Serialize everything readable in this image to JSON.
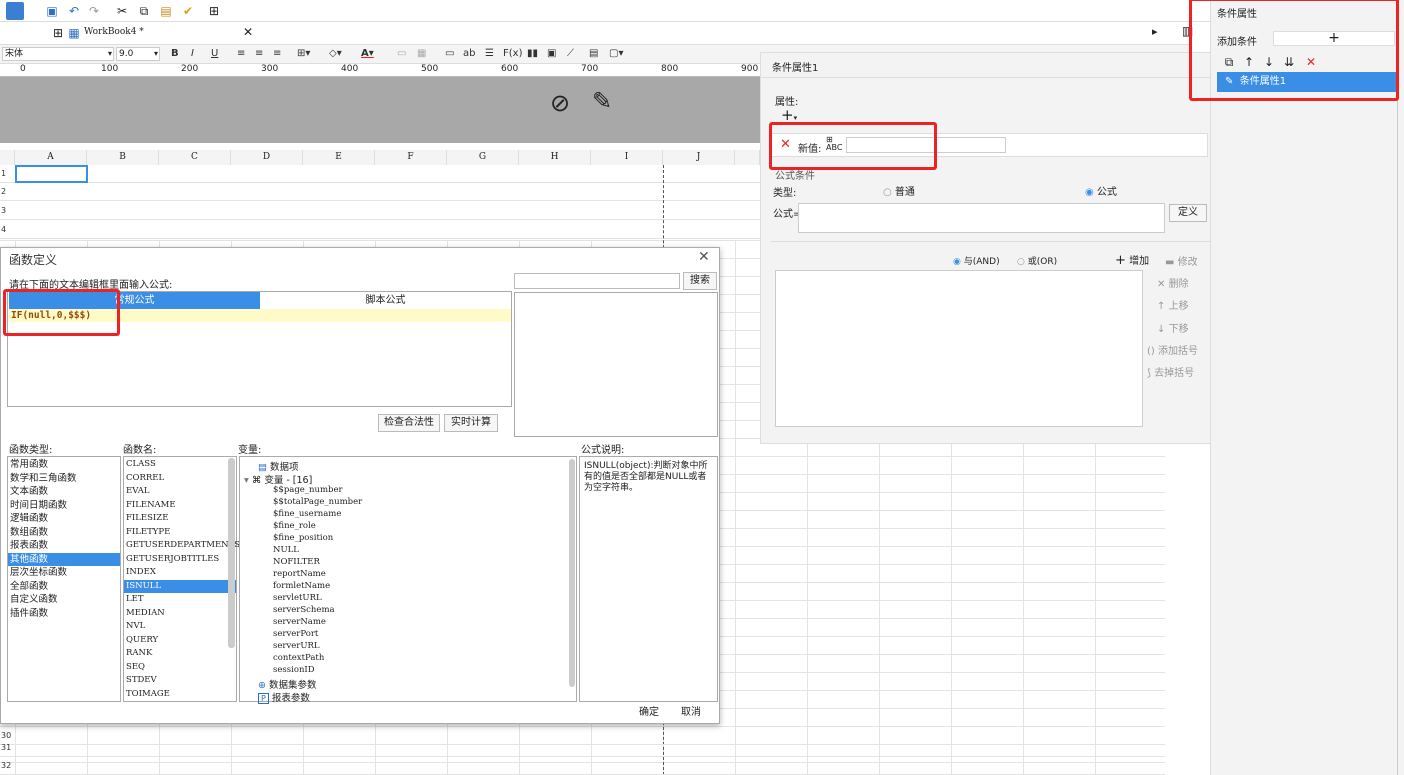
{
  "window": {
    "tab_title": "WorkBook4 *"
  },
  "format": {
    "font_name": "宋体",
    "font_size": "9.0"
  },
  "ruler": {
    "marks": [
      "0",
      "100",
      "200",
      "300",
      "400",
      "500",
      "600",
      "700",
      "800",
      "900"
    ]
  },
  "sheet": {
    "columns": [
      "A",
      "B",
      "C",
      "D",
      "E",
      "F",
      "G",
      "H",
      "I",
      "J"
    ],
    "rows_top": [
      "1",
      "2",
      "3",
      "4"
    ],
    "rows_bottom": [
      "30",
      "31",
      "32"
    ]
  },
  "dialog": {
    "title": "函数定义",
    "prompt": "请在下面的文本编辑框里面输入公式:",
    "search_placeholder": "",
    "search_button": "搜索",
    "tab_regular": "常规公式",
    "tab_script": "脚本公式",
    "formula_text": "IF(null,0,$$$)",
    "check_button": "检查合法性",
    "calc_button": "实时计算",
    "func_type_label": "函数类型:",
    "func_name_label": "函数名:",
    "var_label": "变量:",
    "desc_label": "公式说明:",
    "func_types": [
      "常用函数",
      "数学和三角函数",
      "文本函数",
      "时间日期函数",
      "逻辑函数",
      "数组函数",
      "报表函数",
      "其他函数",
      "层次坐标函数",
      "全部函数",
      "自定义函数",
      "插件函数"
    ],
    "func_type_selected": 7,
    "func_names": [
      "CLASS",
      "CORREL",
      "EVAL",
      "FILENAME",
      "FILESIZE",
      "FILETYPE",
      "GETUSERDEPARTMENTS",
      "GETUSERJOBTITLES",
      "INDEX",
      "ISNULL",
      "LET",
      "MEDIAN",
      "NVL",
      "QUERY",
      "RANK",
      "SEQ",
      "STDEV",
      "TOIMAGE"
    ],
    "func_name_selected": 9,
    "var_data_item": "数据项",
    "var_group": "变量 - [16]",
    "variables": [
      "$$page_number",
      "$$totalPage_number",
      "$fine_username",
      "$fine_role",
      "$fine_position",
      "NULL",
      "NOFILTER",
      "reportName",
      "formletName",
      "servletURL",
      "serverSchema",
      "serverName",
      "serverPort",
      "serverURL",
      "contextPath",
      "sessionID"
    ],
    "var_dataset_params": "数据集参数",
    "var_report_params": "报表参数",
    "description": "ISNULL(object):判断对象中所有的值是否全部都是NULL或者为空字符串。",
    "ok_button": "确定",
    "cancel_button": "取消"
  },
  "condition": {
    "title": "条件属性1",
    "attr_label": "属性:",
    "new_value_label": "新值:",
    "new_value": "",
    "formula_section": "公式条件",
    "type_label": "类型:",
    "type_normal": "普通",
    "type_formula": "公式",
    "formula_label": "公式=",
    "define_button": "定义",
    "and_label": "与(AND)",
    "or_label": "或(OR)",
    "add_button": "增加",
    "modify_button": "修改",
    "delete_button": "删除",
    "up_button": "上移",
    "down_button": "下移",
    "add_paren_button": "添加括号",
    "remove_paren_button": "去掉括号"
  },
  "right_panel": {
    "title": "条件属性",
    "add_label": "添加条件",
    "item": "条件属性1"
  },
  "colors": {
    "accent": "#3a8ee6",
    "highlight": "#ee2222",
    "formula_bg": "#fffbc8"
  }
}
